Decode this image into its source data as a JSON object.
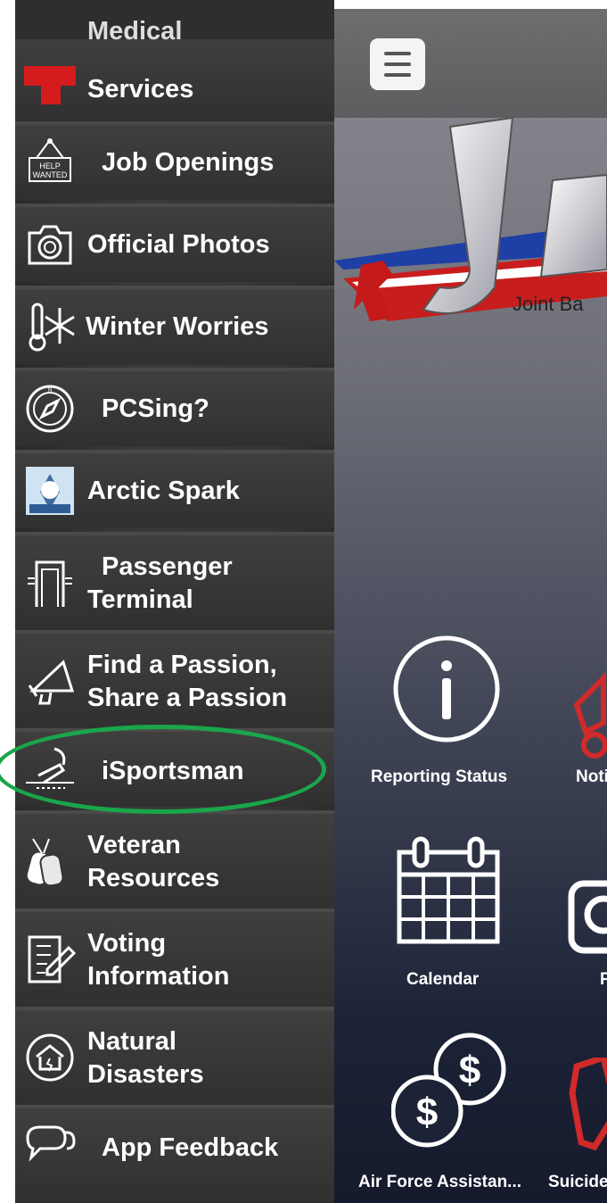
{
  "drawer": {
    "items": [
      {
        "label_line1": "Medical",
        "label_line2": "Services",
        "icon": "red-cross-icon"
      },
      {
        "label": "Job Openings",
        "icon": "help-wanted-sign-icon",
        "icon_text": "HELP WANTED"
      },
      {
        "label": "Official Photos",
        "icon": "camera-icon"
      },
      {
        "label": "Winter Worries",
        "icon": "thermometer-snowflake-icon"
      },
      {
        "label": "PCSing?",
        "icon": "compass-icon"
      },
      {
        "label": "Arctic Spark",
        "icon": "arctic-spark-logo-icon"
      },
      {
        "label_line1": "Passenger",
        "label_line2": "Terminal",
        "icon": "terminal-gate-icon"
      },
      {
        "label_line1": "Find a Passion,",
        "label_line2": "Share a Passion",
        "icon": "megaphone-icon"
      },
      {
        "label": "iSportsman",
        "icon": "fishing-icon"
      },
      {
        "label_line1": "Veteran",
        "label_line2": "Resources",
        "icon": "dog-tags-icon"
      },
      {
        "label_line1": "Voting",
        "label_line2": "Information",
        "icon": "ballot-icon"
      },
      {
        "label_line1": "Natural",
        "label_line2": "Disasters",
        "icon": "disaster-house-icon"
      },
      {
        "label": "App Feedback",
        "icon": "chat-bubbles-icon"
      }
    ],
    "highlight_color": "#1aa64a"
  },
  "main": {
    "banner_text": "Joint Ba",
    "tiles": [
      {
        "label": "Reporting Status",
        "icon": "info-circle-icon"
      },
      {
        "label": "Noti",
        "icon": "megaphone-red-icon"
      },
      {
        "label": "Calendar",
        "icon": "calendar-icon"
      },
      {
        "label": "P",
        "icon": "camera-white-icon"
      },
      {
        "label": "Air Force Assistan...",
        "icon": "dollar-coins-icon"
      },
      {
        "label": "Suicide",
        "icon": "hand-red-icon"
      }
    ]
  }
}
